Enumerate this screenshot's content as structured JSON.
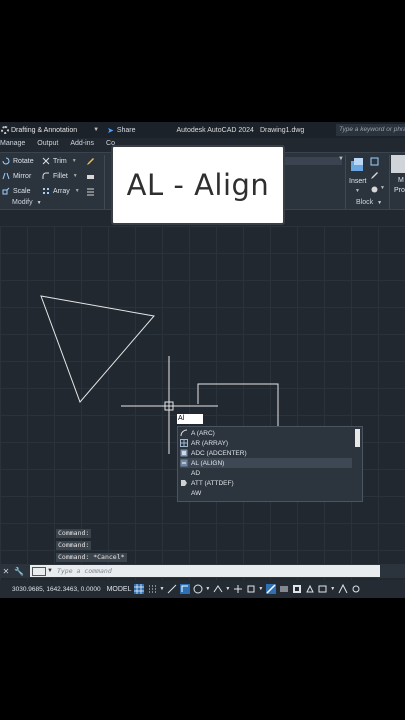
{
  "titlebar": {
    "workspace": "Drafting & Annotation",
    "share": "Share",
    "app_name": "Autodesk AutoCAD 2024",
    "file_name": "Drawing1.dwg",
    "search_placeholder": "Type a keyword or phrase"
  },
  "tabs": [
    "Manage",
    "Output",
    "Add-ins",
    "Co"
  ],
  "ribbon": {
    "modify": {
      "items": [
        "Rotate",
        "Trim",
        "Mirror",
        "Fillet",
        "Scale",
        "Array"
      ],
      "label": "Modify"
    },
    "block": {
      "insert": "Insert",
      "label": "Block",
      "partial": [
        "M",
        "Pro"
      ]
    }
  },
  "banner": {
    "text": "AL - Align"
  },
  "command_input": {
    "value": "Al"
  },
  "autocomplete": {
    "items": [
      "A (ARC)",
      "AR (ARRAY)",
      "ADC (ADCENTER)",
      "AL (ALIGN)",
      "AD",
      "ATT (ATTDEF)",
      "AW"
    ]
  },
  "command_history": [
    "Command:",
    "Command:",
    "Command: *Cancel*"
  ],
  "command_line": {
    "placeholder": "Type a command"
  },
  "statusbar": {
    "coords": "3030.9685, 1642.3463, 0.0000",
    "model": "MODEL"
  },
  "colors": {
    "canvas": "#212830",
    "accent": "#4da3ff",
    "banner_bg": "#ffffff"
  }
}
